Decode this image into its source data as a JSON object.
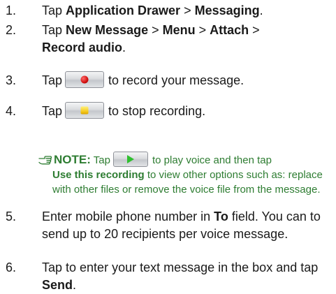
{
  "steps": [
    {
      "num": "1.",
      "pre": "Tap ",
      "b1": "Application Drawer",
      "sep1": " > ",
      "b2": "Messaging",
      "post": "."
    },
    {
      "num": "2.",
      "pre": "Tap ",
      "b1": "New Message",
      "sep1": " > ",
      "b2": "Menu",
      "sep2": " > ",
      "b3": "Attach",
      "sep3": " >",
      "b4": "Record audio",
      "post": "."
    },
    {
      "num": "3.",
      "pre": "Tap",
      "icon": "record-icon",
      "post": "to record your message."
    },
    {
      "num": "4.",
      "pre": "Tap",
      "icon": "stop-icon",
      "post": "to stop recording."
    },
    {
      "num": "5.",
      "text": "Enter mobile phone number in ",
      "b1": "To",
      "text2": " field. You can to send up to 20 recipients per voice message."
    },
    {
      "num": "6.",
      "text": "Tap to enter your text message in the box and tap ",
      "b1": "Send",
      "post": "."
    }
  ],
  "note": {
    "icon": "pointing-hand-icon",
    "label": "NOTE:",
    "pre": " Tap",
    "play_icon": "play-icon",
    "post": "to play voice and then tap",
    "bold": "Use this recording",
    "rest": " to view other options such as: replace with other files or remove the voice file from the message."
  },
  "colors": {
    "text": "#1a1a1a",
    "note": "#2e7d32",
    "record": "#d10f0f",
    "stop": "#f3c517",
    "play": "#2fbf2f"
  }
}
